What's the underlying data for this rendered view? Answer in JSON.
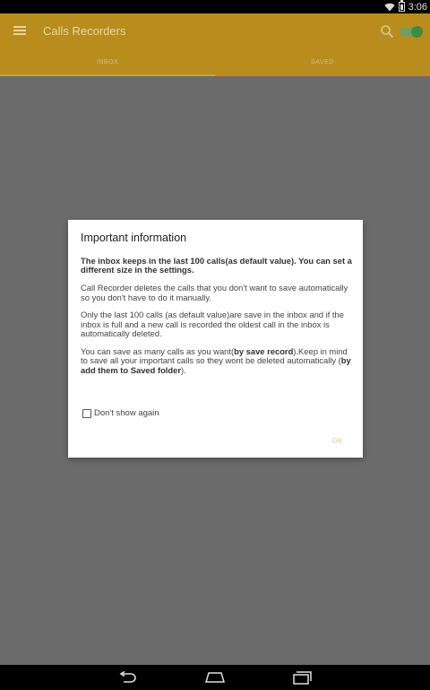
{
  "status_bar": {
    "time": "3:06"
  },
  "app_bar": {
    "title": "Calls Recorders",
    "tabs": [
      {
        "label": "INBOX",
        "active": true
      },
      {
        "label": "SAVED",
        "active": false
      }
    ],
    "record_toggle_on": true,
    "accent_color": "#b88d1d"
  },
  "dialog": {
    "title": "Important information",
    "bold_intro": "The inbox keeps in the last 100 calls(as default value). You can set a different size in the settings.",
    "para1": "Call Recorder deletes the calls that you don't want to save automatically so you don't have to do it manually.",
    "para2": "Only the last 100 calls (as default value)are save in the inbox and if the inbox is full and a new call is recorded the oldest call in the inbox is automatically deleted.",
    "para3_a": "You can save as many calls as you want(",
    "para3_b": "by save record",
    "para3_c": ").Keep in mind to save all your important calls so they wont be deleted automatically (",
    "para3_d": "by add them to Saved folder",
    "para3_e": ").",
    "checkbox_label": "Don't show again",
    "checkbox_checked": false,
    "ok_label": "OK"
  },
  "icons": {
    "menu": "menu-icon",
    "search": "search-icon",
    "back": "back-icon",
    "home": "home-icon",
    "recents": "recents-icon"
  }
}
